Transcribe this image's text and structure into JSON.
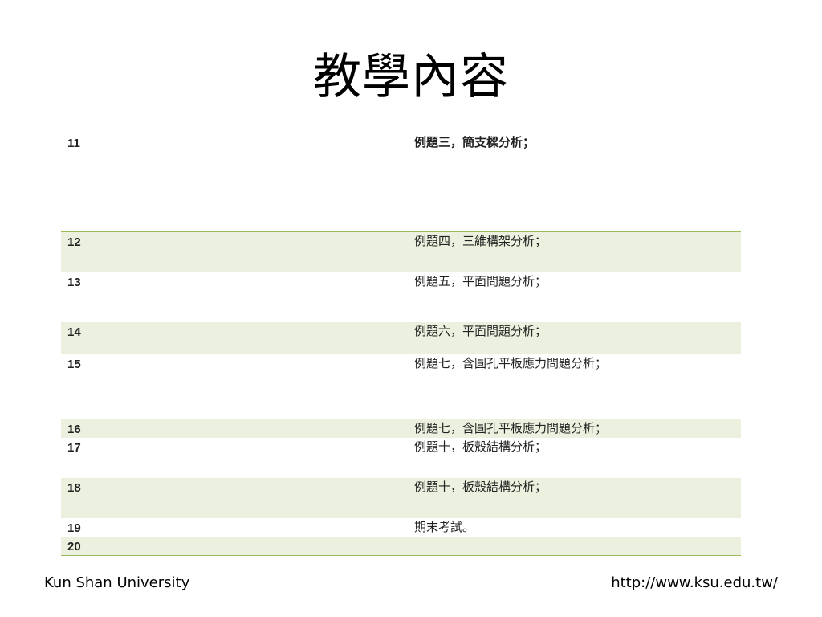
{
  "slide": {
    "title": "教學內容"
  },
  "schedule": {
    "rows": [
      {
        "week": "11",
        "topic": "例題三，簡支樑分析；"
      },
      {
        "week": "12",
        "topic": "例題四，三維構架分析；"
      },
      {
        "week": "13",
        "topic": "例題五，平面問題分析；"
      },
      {
        "week": "14",
        "topic": "例題六，平面問題分析；"
      },
      {
        "week": "15",
        "topic": "例題七，含圓孔平板應力問題分析；"
      },
      {
        "week": "16",
        "topic": "例題七，含圓孔平板應力問題分析；"
      },
      {
        "week": "17",
        "topic": "例題十，板殼結構分析；"
      },
      {
        "week": "18",
        "topic": "例題十，板殼結構分析；"
      },
      {
        "week": "19",
        "topic": "期末考試。"
      },
      {
        "week": "20",
        "topic": ""
      }
    ]
  },
  "footer": {
    "left": "Kun Shan University",
    "right": "http://www.ksu.edu.tw/"
  },
  "colors": {
    "accent_line": "#9bbb59",
    "band_fill": "#ebf1de"
  }
}
